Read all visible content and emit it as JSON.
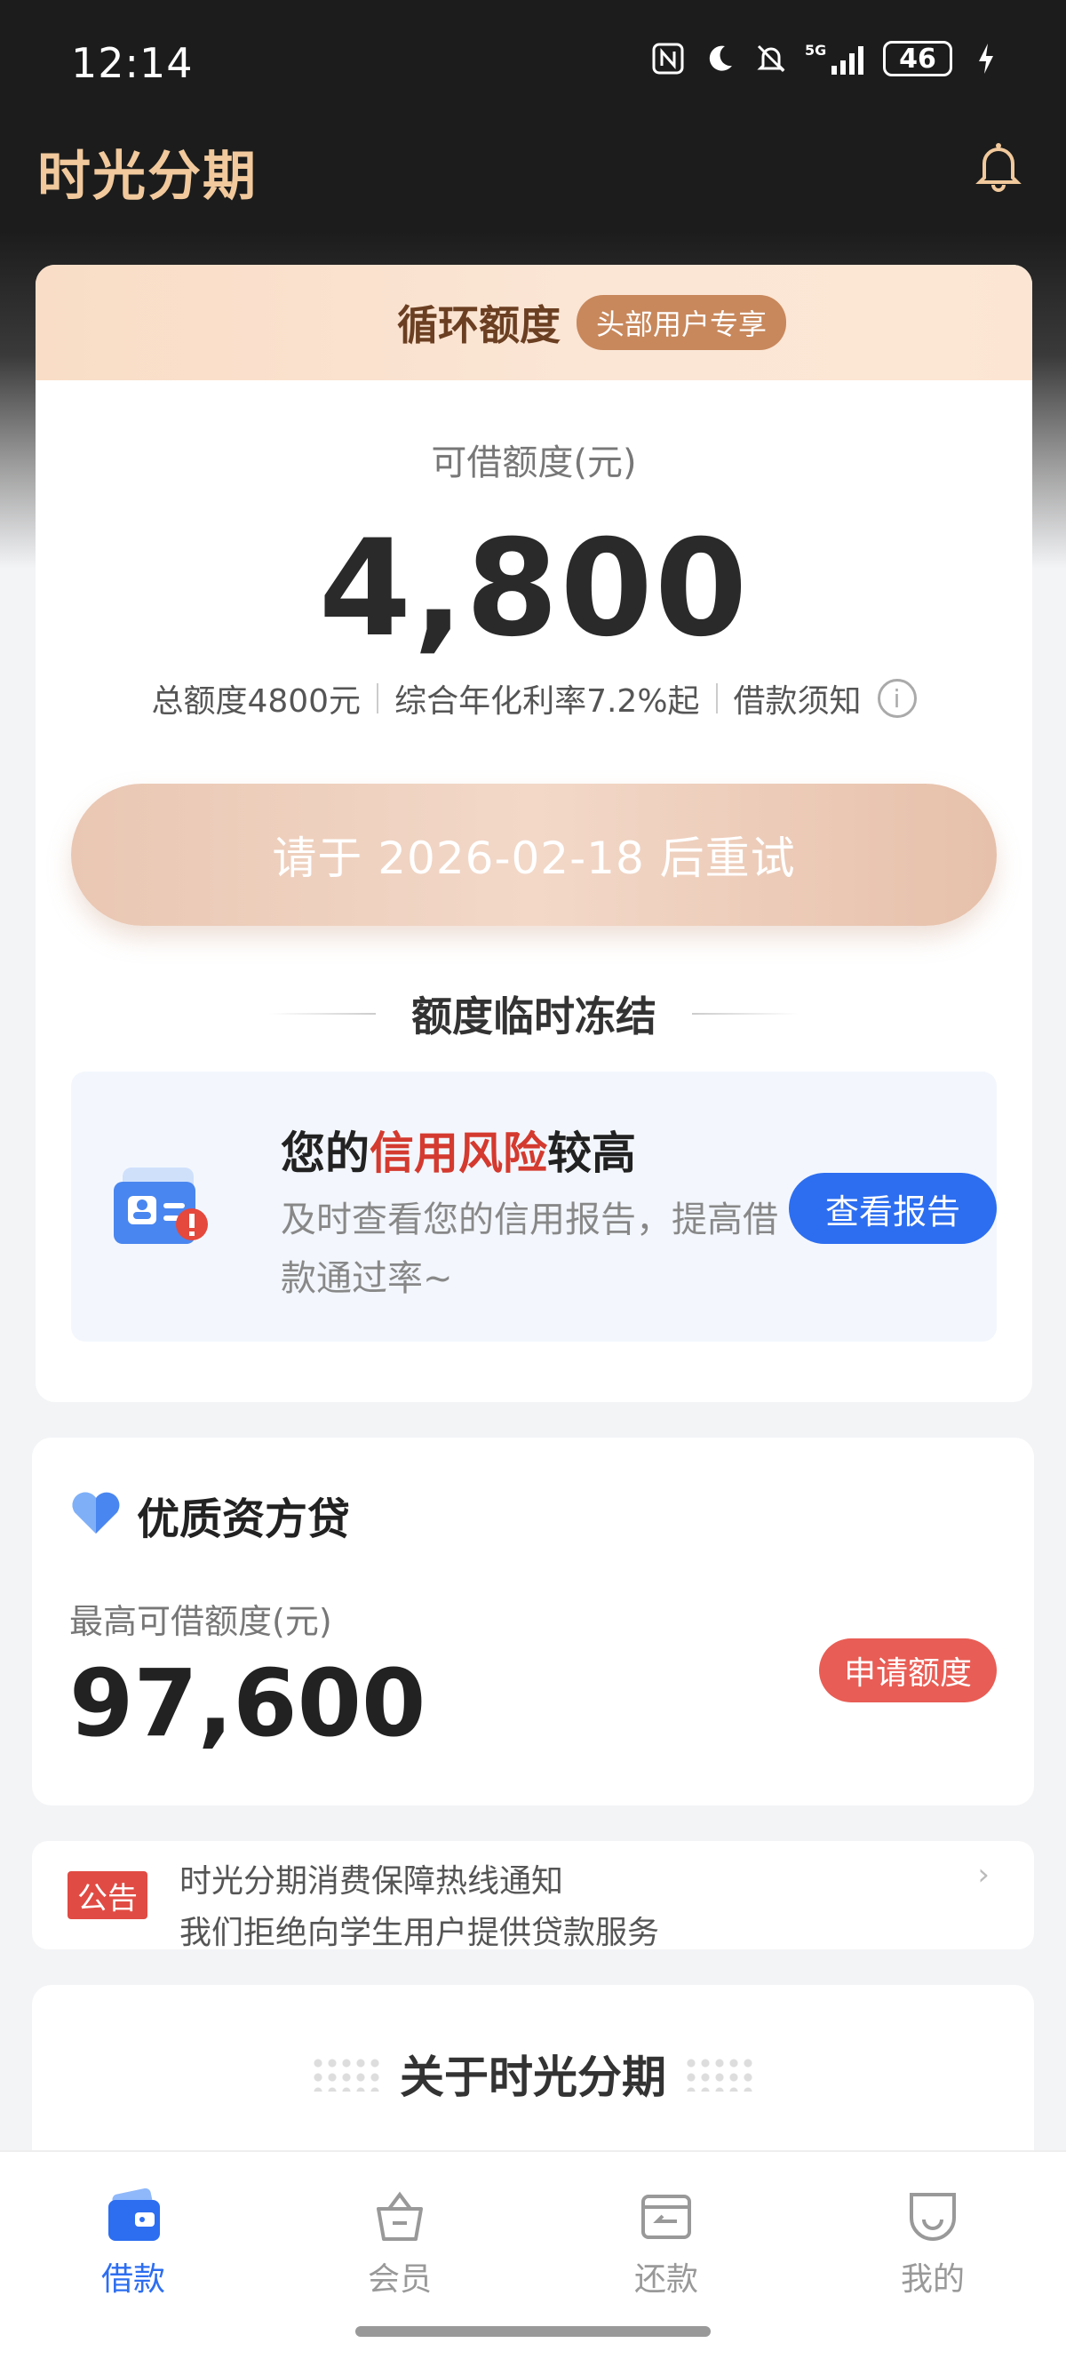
{
  "status_bar": {
    "time": "12:14",
    "battery": "46"
  },
  "header": {
    "app_title": "时光分期"
  },
  "credit_card": {
    "title": "循环额度",
    "badge": "头部用户专享",
    "available_label": "可借额度(元)",
    "available_amount": "4,800",
    "total_limit": "总额度4800元",
    "rate": "综合年化利率7.2%起",
    "loan_notice": "借款须知",
    "retry_button": "请于 2026-02-18 后重试",
    "freeze_title": "额度临时冻结",
    "risk": {
      "title_prefix": "您的",
      "title_highlight": "信用风险",
      "title_suffix": "较高",
      "description": "及时查看您的信用报告，提高借款通过率~",
      "report_button": "查看报告"
    }
  },
  "premium_loan": {
    "title": "优质资方贷",
    "max_label": "最高可借额度(元)",
    "max_amount": "97,600",
    "apply_button": "申请额度"
  },
  "notice": {
    "tag": "公告",
    "line1": "时光分期消费保障热线通知",
    "line2": "我们拒绝向学生用户提供贷款服务"
  },
  "about": {
    "title": "关于时光分期"
  },
  "bottom_nav": [
    {
      "label": "借款",
      "active": true
    },
    {
      "label": "会员",
      "active": false
    },
    {
      "label": "还款",
      "active": false
    },
    {
      "label": "我的",
      "active": false
    }
  ],
  "colors": {
    "accent_blue": "#2d6ef0",
    "red": "#e85d55",
    "gold": "#f1c99c"
  }
}
